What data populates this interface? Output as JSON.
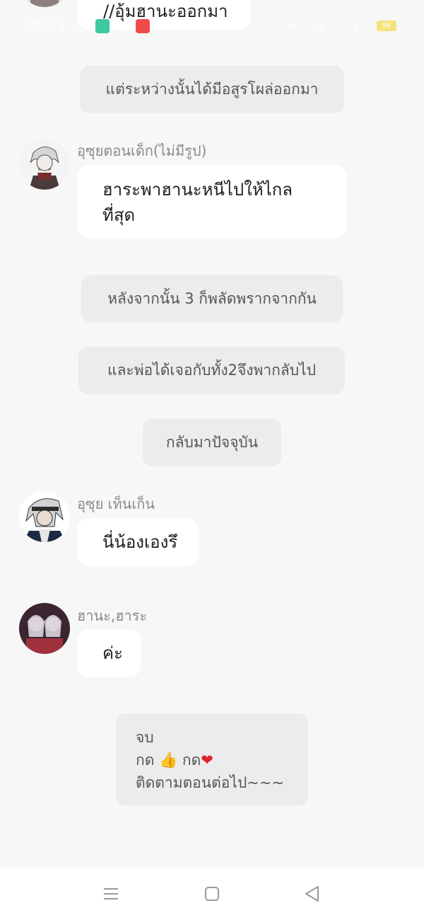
{
  "status_bar": {
    "time": "09:23",
    "battery": "96"
  },
  "messages": {
    "top_partial": "//อุ้มฮานะออกมา",
    "narration_1": "แต่ระหว่างนั้นได้มีอสูรโผล่ออกมา",
    "msg_1": {
      "sender": "อุซุยตอนเด็ก(ไม่มีรูป)",
      "line1": "ฮาระพาฮานะหนีไปให้ไกล",
      "line2": "ที่สุด"
    },
    "narration_2": "หลังจากนั้น 3 ก็พลัดพรากจากกัน",
    "narration_3": "และพ่อได้เจอกับทั้ง2จึงพากลับไป",
    "narration_4": "กลับมาปัจจุบัน",
    "msg_2": {
      "sender": "อุซุย เท็นเก็น",
      "text": "นี่น้องเองรึ"
    },
    "msg_3": {
      "sender": "ฮานะ,ฮาระ",
      "text": "ค่ะ"
    },
    "ending": {
      "line1": "จบ",
      "line2_a": "กด",
      "thumbs": "👍",
      "line2_b": "กด",
      "heart": "❤",
      "line3": "ติดตามตอนต่อไป~~~"
    }
  },
  "icons": {
    "nav_menu": "menu-icon",
    "nav_home": "home-icon",
    "nav_back": "back-icon"
  },
  "colors": {
    "background": "#f7f7f7",
    "bubble": "#ffffff",
    "narration": "#ececec",
    "heart": "#e0232e"
  }
}
